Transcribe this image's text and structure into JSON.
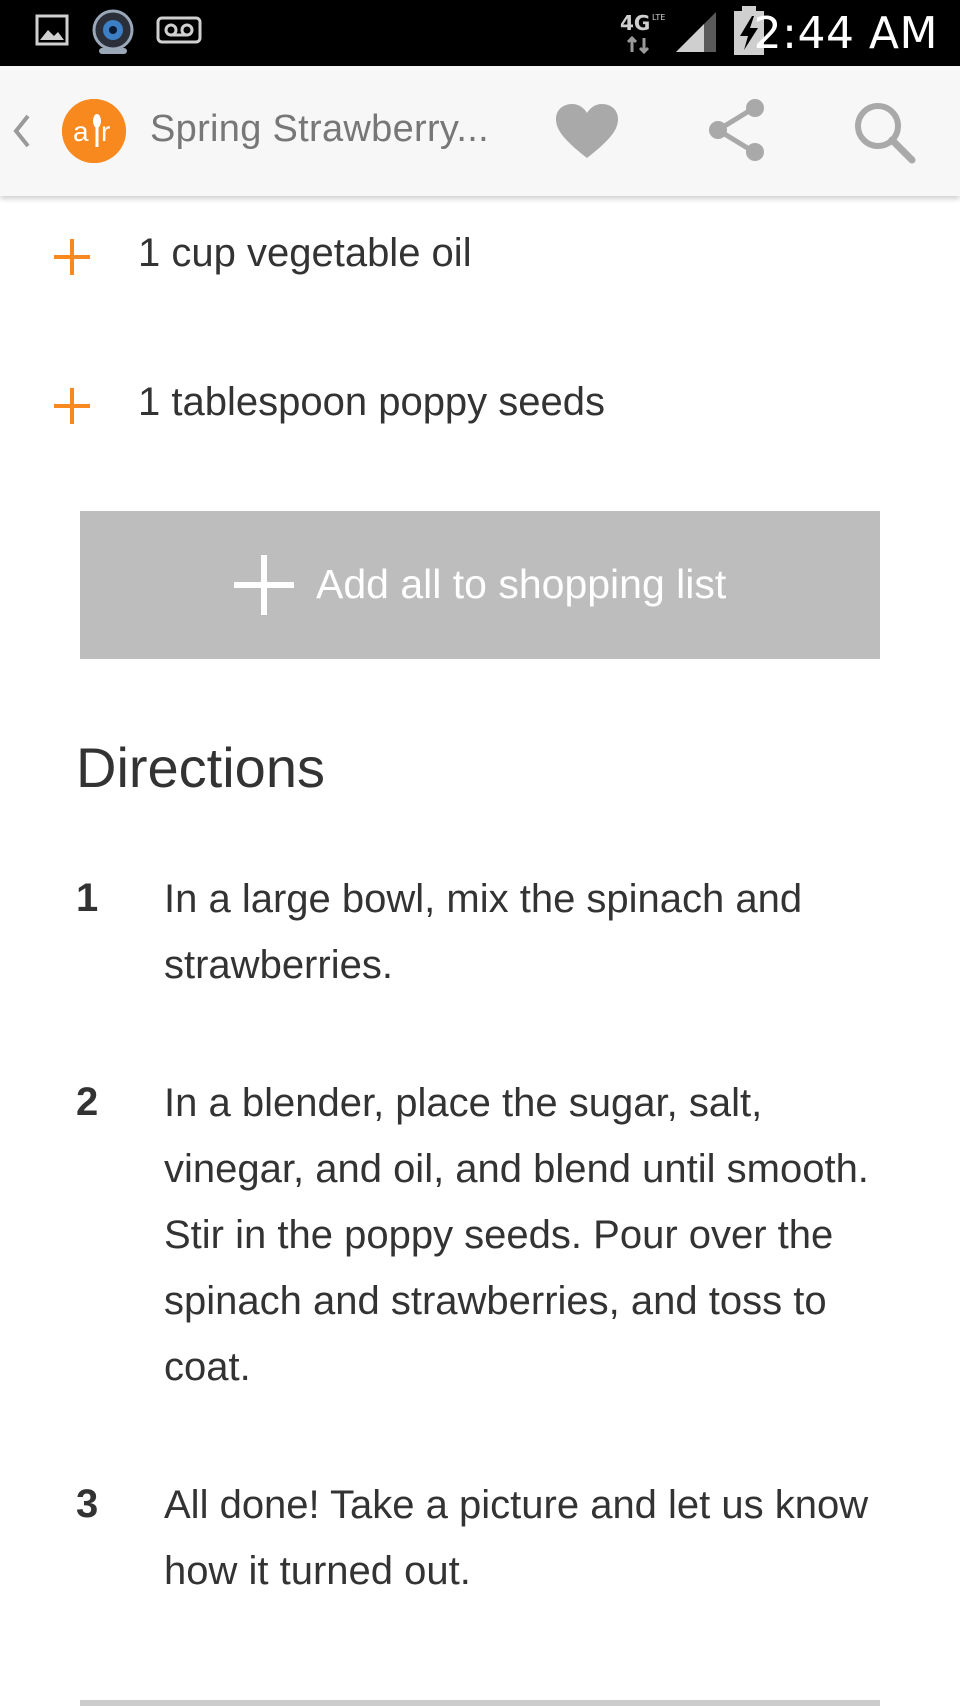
{
  "status_bar": {
    "time": "2:44 AM",
    "network": "4G LTE",
    "icons": [
      "image-icon",
      "camera-icon",
      "voicemail-icon",
      "network-4g-icon",
      "signal-icon",
      "battery-charging-icon"
    ]
  },
  "app_bar": {
    "title": "Spring Strawberry...",
    "logo_text": "a|r",
    "icons": [
      "back-chevron-icon",
      "heart-icon",
      "share-icon",
      "search-icon"
    ]
  },
  "ingredients": [
    {
      "text": "1 cup vegetable oil"
    },
    {
      "text": "1 tablespoon poppy seeds"
    }
  ],
  "add_all": {
    "label": "Add all to shopping list"
  },
  "directions": {
    "heading": "Directions",
    "steps": [
      {
        "number": "1",
        "text": "In a large bowl, mix the spinach and strawberries."
      },
      {
        "number": "2",
        "text": "In a blender, place the sugar, salt, vinegar, and oil, and blend until smooth. Stir in the poppy seeds. Pour over the spinach and strawberries, and toss to coat."
      },
      {
        "number": "3",
        "text": "All done! Take a picture and let us know how it turned out."
      }
    ]
  },
  "colors": {
    "accent": "#f7891f",
    "status_bar": "#000000",
    "app_bar": "#f7f7f7",
    "button_gray": "#bdbdbd",
    "icon_gray": "#a9a9a9",
    "text": "#333333"
  }
}
